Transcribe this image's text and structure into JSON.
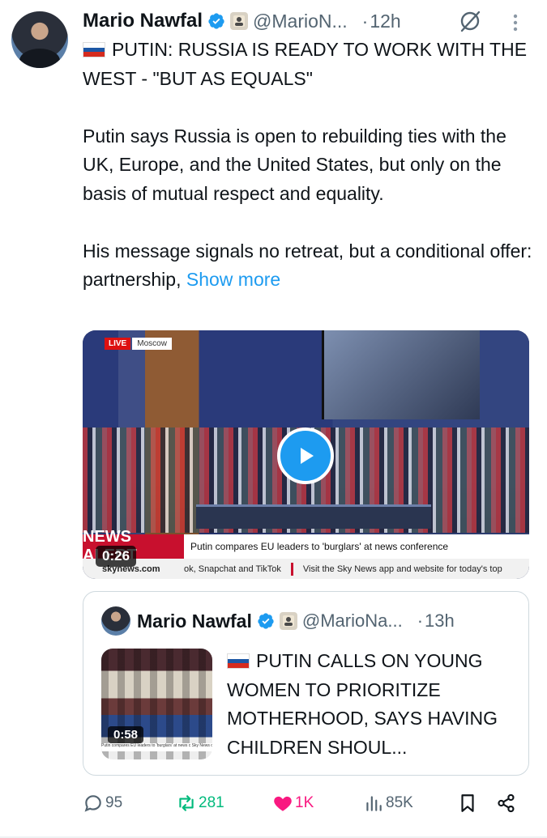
{
  "tweet": {
    "author_name": "Mario Nawfal",
    "handle": "@MarioN...",
    "dot": "·",
    "time": "12h",
    "headline": "PUTIN: RUSSIA IS READY TO WORK WITH THE WEST - \"BUT AS EQUALS\"",
    "paragraph1": "Putin says Russia is open to rebuilding ties with the UK, Europe, and the United States, but only on the basis of mutual respect and equality.",
    "paragraph2": "His message signals no retreat, but a conditional offer: partnership,",
    "show_more": "Show more"
  },
  "video": {
    "live_label": "LIVE",
    "location": "Moscow",
    "alert_label": "NEWS ALERT",
    "headline": "Putin compares EU leaders to 'burglars' at news conference",
    "ticker_logo": "skynews.com",
    "ticker_left": "ok, Snapchat and TikTok",
    "ticker_right": "Visit the Sky News app and website for today's top",
    "duration": "0:26"
  },
  "quoted": {
    "author_name": "Mario Nawfal",
    "handle": "@MarioNa...",
    "dot": "·",
    "time": "13h",
    "text": "PUTIN CALLS ON YOUNG WOMEN TO PRIORITIZE MOTHERHOOD, SAYS HAVING CHILDREN SHOUL...",
    "duration": "0:58",
    "strip": "Putin compares EU leaders to 'burglars' at news c  Sky News on X, Instagram, Facebook, Snapchat and TikTo"
  },
  "actions": {
    "replies": "95",
    "reposts": "281",
    "likes": "1K",
    "views": "85K"
  },
  "colors": {
    "accent": "#1d9bf0",
    "repost": "#00ba7c",
    "like": "#f91880",
    "muted": "#536471"
  }
}
